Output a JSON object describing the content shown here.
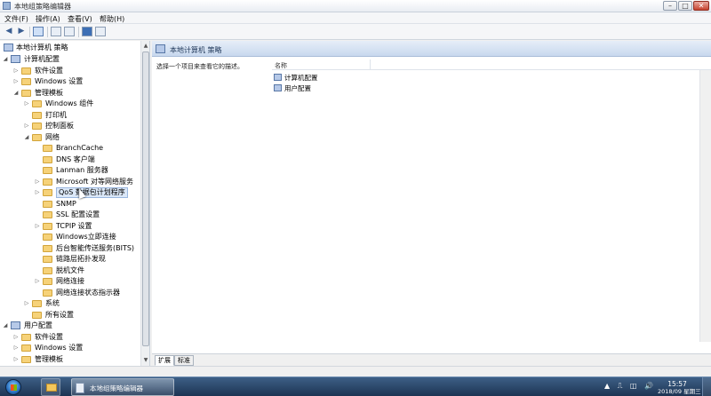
{
  "window": {
    "title": "本地组策略编辑器"
  },
  "titlebar_buttons": {
    "minimize": "–",
    "maximize": "□",
    "close": "✕"
  },
  "menu": [
    "文件(F)",
    "操作(A)",
    "查看(V)",
    "帮助(H)"
  ],
  "toolbar": {
    "back_glyph": "◀",
    "forward_glyph": "▶",
    "icons": [
      "back-arrow-icon",
      "forward-arrow-icon",
      "show-hide-tree-icon",
      "properties-icon",
      "export-list-icon",
      "help-icon",
      "console-view-icon"
    ]
  },
  "tree": {
    "root": "本地计算机 策略",
    "items": [
      {
        "label": "计算机配置",
        "level": 1,
        "expander": "◢",
        "type": "pc"
      },
      {
        "label": "软件设置",
        "level": 2,
        "expander": "▷",
        "type": "folder"
      },
      {
        "label": "Windows 设置",
        "level": 2,
        "expander": "▷",
        "type": "folder"
      },
      {
        "label": "管理模板",
        "level": 2,
        "expander": "◢",
        "type": "folder"
      },
      {
        "label": "Windows 组件",
        "level": 3,
        "expander": "▷",
        "type": "folder"
      },
      {
        "label": "打印机",
        "level": 3,
        "expander": "",
        "type": "folder"
      },
      {
        "label": "控制面板",
        "level": 3,
        "expander": "▷",
        "type": "folder"
      },
      {
        "label": "网络",
        "level": 3,
        "expander": "◢",
        "type": "folder"
      },
      {
        "label": "BranchCache",
        "level": 4,
        "expander": "",
        "type": "folder"
      },
      {
        "label": "DNS 客户端",
        "level": 4,
        "expander": "",
        "type": "folder"
      },
      {
        "label": "Lanman 服务器",
        "level": 4,
        "expander": "",
        "type": "folder"
      },
      {
        "label": "Microsoft 对等网络服务",
        "level": 4,
        "expander": "▷",
        "type": "folder"
      },
      {
        "label": "QoS 数据包计划程序",
        "level": 4,
        "expander": "▷",
        "type": "folder",
        "hovered": true
      },
      {
        "label": "SNMP",
        "level": 4,
        "expander": "",
        "type": "folder"
      },
      {
        "label": "SSL 配置设置",
        "level": 4,
        "expander": "",
        "type": "folder"
      },
      {
        "label": "TCPIP 设置",
        "level": 4,
        "expander": "▷",
        "type": "folder"
      },
      {
        "label": "Windows立即连接",
        "level": 4,
        "expander": "",
        "type": "folder"
      },
      {
        "label": "后台智能传送服务(BITS)",
        "level": 4,
        "expander": "",
        "type": "folder"
      },
      {
        "label": "链路层拓扑发现",
        "level": 4,
        "expander": "",
        "type": "folder"
      },
      {
        "label": "脱机文件",
        "level": 4,
        "expander": "",
        "type": "folder"
      },
      {
        "label": "网络连接",
        "level": 4,
        "expander": "▷",
        "type": "folder"
      },
      {
        "label": "网络连接状态指示器",
        "level": 4,
        "expander": "",
        "type": "folder"
      },
      {
        "label": "系统",
        "level": 3,
        "expander": "▷",
        "type": "folder"
      },
      {
        "label": "所有设置",
        "level": 3,
        "expander": "",
        "type": "folder"
      },
      {
        "label": "用户配置",
        "level": 1,
        "expander": "◢",
        "type": "pc"
      },
      {
        "label": "软件设置",
        "level": 2,
        "expander": "▷",
        "type": "folder"
      },
      {
        "label": "Windows 设置",
        "level": 2,
        "expander": "▷",
        "type": "folder"
      },
      {
        "label": "管理模板",
        "level": 2,
        "expander": "▷",
        "type": "folder"
      }
    ]
  },
  "scroll_glyphs": {
    "up": "▲",
    "down": "▼"
  },
  "right_pane": {
    "header": "本地计算机 策略",
    "description": "选择一个项目来查看它的描述。",
    "column_name": "名称",
    "rows": [
      "计算机配置",
      "用户配置"
    ],
    "tabs": [
      "扩展",
      "标准"
    ]
  },
  "taskbar": {
    "active_app": "本地组策略编辑器",
    "tray_icons": [
      "▲",
      "⎍",
      "◫",
      "🔊"
    ],
    "time": "15:57",
    "date": "2018/09 星期三"
  }
}
